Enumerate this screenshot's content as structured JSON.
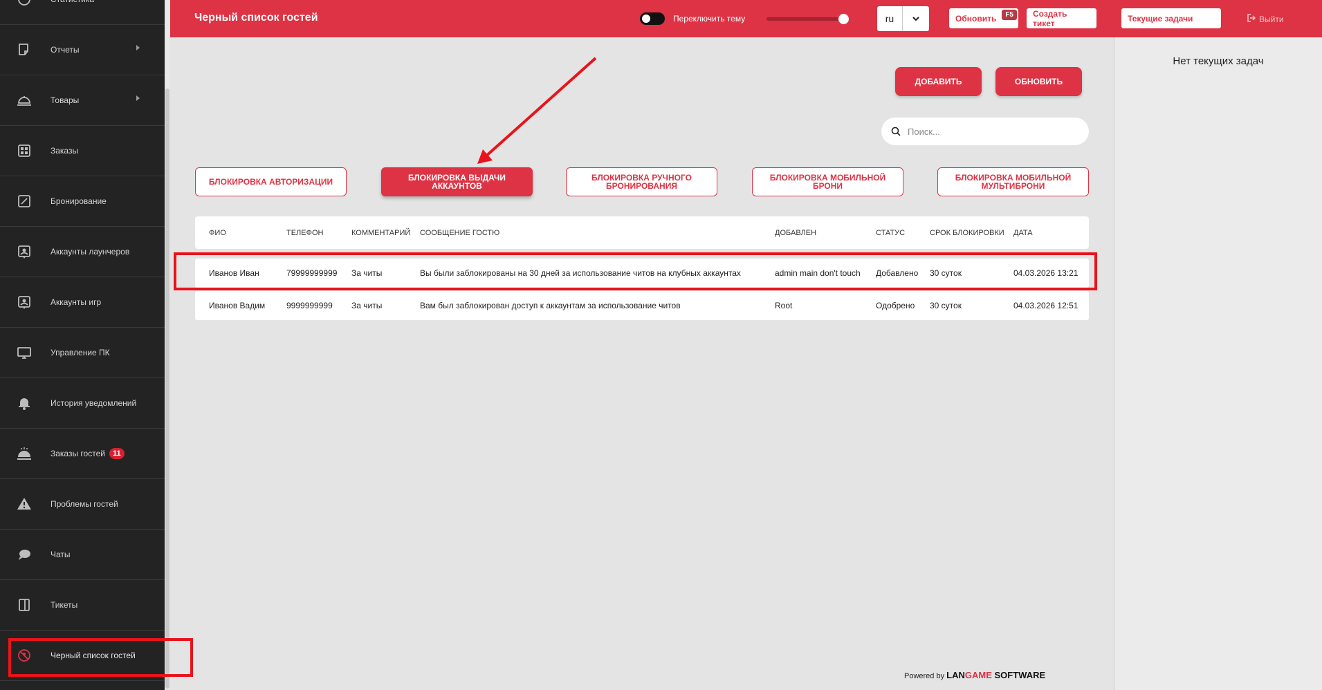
{
  "sidebar": {
    "items": [
      {
        "label": "Статистика",
        "icon": "chart-pie-icon",
        "has_submenu": false
      },
      {
        "label": "Отчеты",
        "icon": "report-icon",
        "has_submenu": true
      },
      {
        "label": "Товары",
        "icon": "cloche-icon",
        "has_submenu": true
      },
      {
        "label": "Заказы",
        "icon": "orders-grid-icon",
        "has_submenu": false
      },
      {
        "label": "Бронирование",
        "icon": "booking-icon",
        "has_submenu": false
      },
      {
        "label": "Аккаунты лаунчеров",
        "icon": "launcher-account-icon",
        "has_submenu": false
      },
      {
        "label": "Аккаунты игр",
        "icon": "game-account-icon",
        "has_submenu": false
      },
      {
        "label": "Управление ПК",
        "icon": "monitor-icon",
        "has_submenu": false
      },
      {
        "label": "История уведомлений",
        "icon": "bell-icon",
        "has_submenu": false
      },
      {
        "label": "Заказы гостей",
        "icon": "guest-orders-icon",
        "has_submenu": false,
        "badge": "11"
      },
      {
        "label": "Проблемы гостей",
        "icon": "warning-icon",
        "has_submenu": false
      },
      {
        "label": "Чаты",
        "icon": "chat-icon",
        "has_submenu": false
      },
      {
        "label": "Тикеты",
        "icon": "ticket-icon",
        "has_submenu": false
      },
      {
        "label": "Черный список гостей",
        "icon": "blacklist-icon",
        "has_submenu": false,
        "active": true
      }
    ]
  },
  "header": {
    "title": "Черный список гостей",
    "theme_toggle_label": "Переключить тему",
    "language": "ru",
    "refresh_label": "Обновить",
    "refresh_hotkey": "F5",
    "create_ticket_label": "Создать тикет",
    "current_tasks_label": "Текущие задачи",
    "logout_label": "Выйти"
  },
  "right_panel": {
    "no_tasks_text": "Нет текущих задач"
  },
  "actions": {
    "add_label": "ДОБАВИТЬ",
    "refresh_label": "ОБНОВИТЬ"
  },
  "search": {
    "placeholder": "Поиск..."
  },
  "tabs": [
    {
      "label": "БЛОКИРОВКА АВТОРИЗАЦИИ",
      "active": false
    },
    {
      "label": "БЛОКИРОВКА ВЫДАЧИ АККАУНТОВ",
      "active": true
    },
    {
      "label": "БЛОКИРОВКА РУЧНОГО БРОНИРОВАНИЯ",
      "active": false
    },
    {
      "label": "БЛОКИРОВКА МОБИЛЬНОЙ БРОНИ",
      "active": false
    },
    {
      "label": "БЛОКИРОВКА МОБИЛЬНОЙ МУЛЬТИБРОНИ",
      "active": false
    }
  ],
  "table": {
    "columns": [
      "ФИО",
      "ТЕЛЕФОН",
      "КОММЕНТАРИЙ",
      "СООБЩЕНИЕ ГОСТЮ",
      "ДОБАВЛЕН",
      "СТАТУС",
      "СРОК БЛОКИРОВКИ",
      "ДАТА"
    ],
    "rows": [
      [
        "Иванов Иван",
        "79999999999",
        "За читы",
        "Вы были заблокированы на 30 дней за использование читов на клубных аккаунтах",
        "admin main don't touch",
        "Добавлено",
        "30 суток",
        "04.03.2026 13:21"
      ],
      [
        "Иванов Вадим",
        "9999999999",
        "За читы",
        "Вам был заблокирован доступ к аккаунтам за использование читов",
        "Root",
        "Одобрено",
        "30 суток",
        "04.03.2026 12:51"
      ]
    ]
  },
  "footer": {
    "powered_by": "Powered by",
    "brand_part1": "LAN",
    "brand_part2": "GAME",
    "brand_part3": " SOFTWARE"
  },
  "colors": {
    "accent": "#dd3344",
    "sidebar_bg": "#232323",
    "annotation_red": "#e8131b"
  }
}
